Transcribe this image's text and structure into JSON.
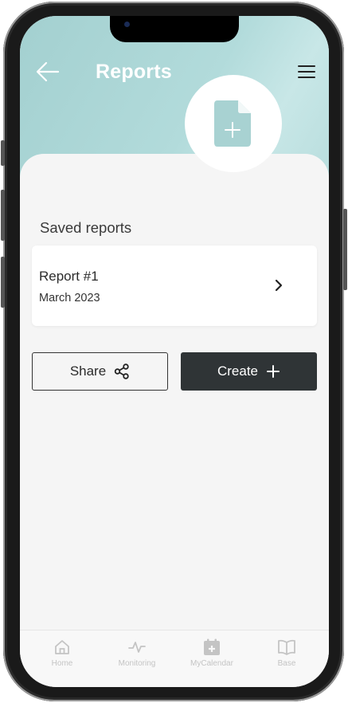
{
  "header": {
    "title": "Reports"
  },
  "section": {
    "saved_reports_title": "Saved reports"
  },
  "reports": [
    {
      "title": "Report #1",
      "date": "March 2023"
    }
  ],
  "actions": {
    "share_label": "Share",
    "create_label": "Create"
  },
  "tabbar": {
    "items": [
      {
        "label": "Home",
        "icon": "home-icon"
      },
      {
        "label": "Monitoring",
        "icon": "pulse-icon"
      },
      {
        "label": "MyCalendar",
        "icon": "calendar-plus-icon"
      },
      {
        "label": "Base",
        "icon": "book-icon"
      }
    ]
  },
  "colors": {
    "header_teal": "#a3d0d0",
    "icon_teal": "#a8d2d2",
    "primary_dark": "#2f3436",
    "background": "#f5f5f5",
    "tab_inactive": "#c4c4c4"
  }
}
